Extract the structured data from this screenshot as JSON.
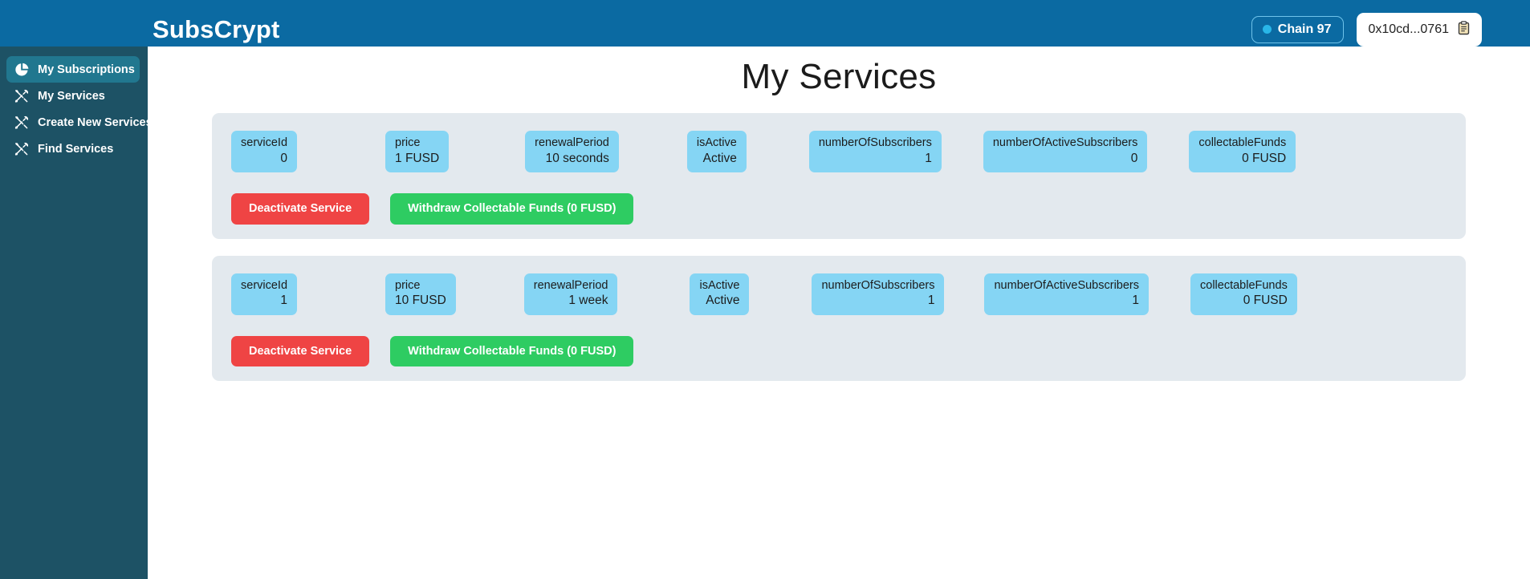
{
  "header": {
    "brand": "SubsCrypt",
    "chain": {
      "label": "Chain 97",
      "dot_color": "#29b6e8",
      "icon": "chain-status-dot"
    },
    "wallet": {
      "address": "0x10cd...0761",
      "copy_icon": "clipboard-icon"
    },
    "background_color": "#0b6aa2"
  },
  "sidebar": {
    "background_color": "#1d5265",
    "active_color": "#21778f",
    "items": [
      {
        "label": "My Subscriptions",
        "icon": "pie-chart-icon",
        "active": true
      },
      {
        "label": "My Services",
        "icon": "tools-icon",
        "active": false
      },
      {
        "label": "Create New Services",
        "icon": "tools-icon",
        "active": false
      },
      {
        "label": "Find Services",
        "icon": "tools-icon",
        "active": false
      }
    ]
  },
  "main": {
    "title": "My Services",
    "card_background": "#e3e9ee",
    "chip_background": "#85d5f4",
    "field_labels": {
      "serviceId": "serviceId",
      "price": "price",
      "renewalPeriod": "renewalPeriod",
      "isActive": "isActive",
      "numberOfSubscribers": "numberOfSubscribers",
      "numberOfActiveSubscribers": "numberOfActiveSubscribers",
      "collectableFunds": "collectableFunds"
    },
    "services": [
      {
        "fields": [
          {
            "label": "serviceId",
            "value": "0"
          },
          {
            "label": "price",
            "value": "1 FUSD"
          },
          {
            "label": "renewalPeriod",
            "value": "10 seconds"
          },
          {
            "label": "isActive",
            "value": "Active"
          },
          {
            "label": "numberOfSubscribers",
            "value": "1"
          },
          {
            "label": "numberOfActiveSubscribers",
            "value": "0"
          },
          {
            "label": "collectableFunds",
            "value": "0 FUSD"
          }
        ],
        "deactivate_label": "Deactivate Service",
        "withdraw_label": "Withdraw Collectable Funds (0 FUSD)"
      },
      {
        "fields": [
          {
            "label": "serviceId",
            "value": "1"
          },
          {
            "label": "price",
            "value": "10 FUSD"
          },
          {
            "label": "renewalPeriod",
            "value": "1 week"
          },
          {
            "label": "isActive",
            "value": "Active"
          },
          {
            "label": "numberOfSubscribers",
            "value": "1"
          },
          {
            "label": "numberOfActiveSubscribers",
            "value": "1"
          },
          {
            "label": "collectableFunds",
            "value": "0 FUSD"
          }
        ],
        "deactivate_label": "Deactivate Service",
        "withdraw_label": "Withdraw Collectable Funds (0 FUSD)"
      }
    ]
  },
  "colors": {
    "danger": "#ef4444",
    "success": "#2ecc62",
    "brand_blue": "#0b6aa2",
    "chip_blue": "#85d5f4"
  }
}
